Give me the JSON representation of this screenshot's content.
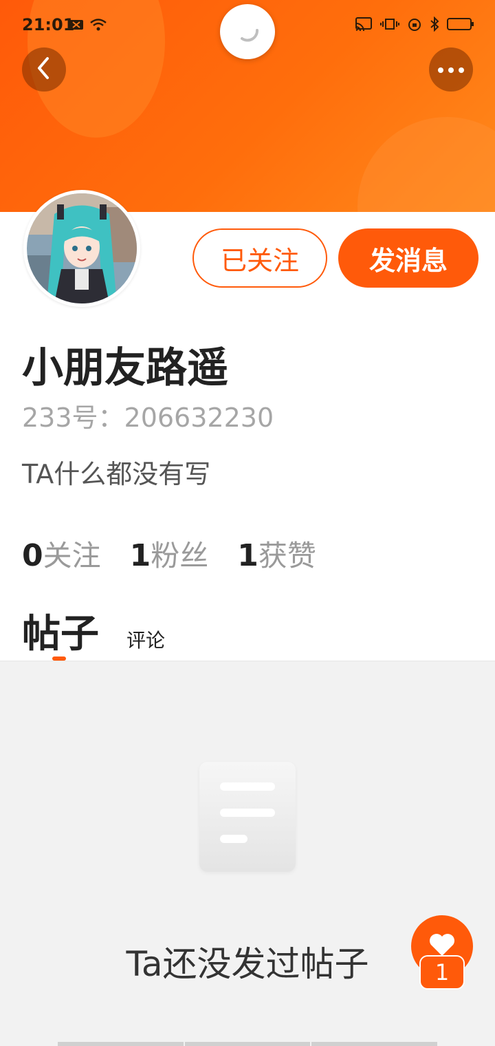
{
  "status_bar": {
    "time": "21:01"
  },
  "header": {
    "loader_icon": "spinner-icon",
    "back_icon": "chevron-left-icon",
    "more_icon": "more-dots-icon"
  },
  "profile": {
    "follow_label": "已关注",
    "message_label": "发消息",
    "nickname": "小朋友路遥",
    "uid_text": "233号：206632230",
    "bio": "TA什么都没有写"
  },
  "stats": [
    {
      "count": "0",
      "label": "关注"
    },
    {
      "count": "1",
      "label": "粉丝"
    },
    {
      "count": "1",
      "label": "获赞"
    }
  ],
  "tabs": {
    "posts": "帖子",
    "comments": "评论"
  },
  "empty_state": {
    "message": "Ta还没发过帖子"
  },
  "fab": {
    "icon": "heart-icon",
    "badge": "1"
  },
  "colors": {
    "accent": "#ff5a0a"
  }
}
